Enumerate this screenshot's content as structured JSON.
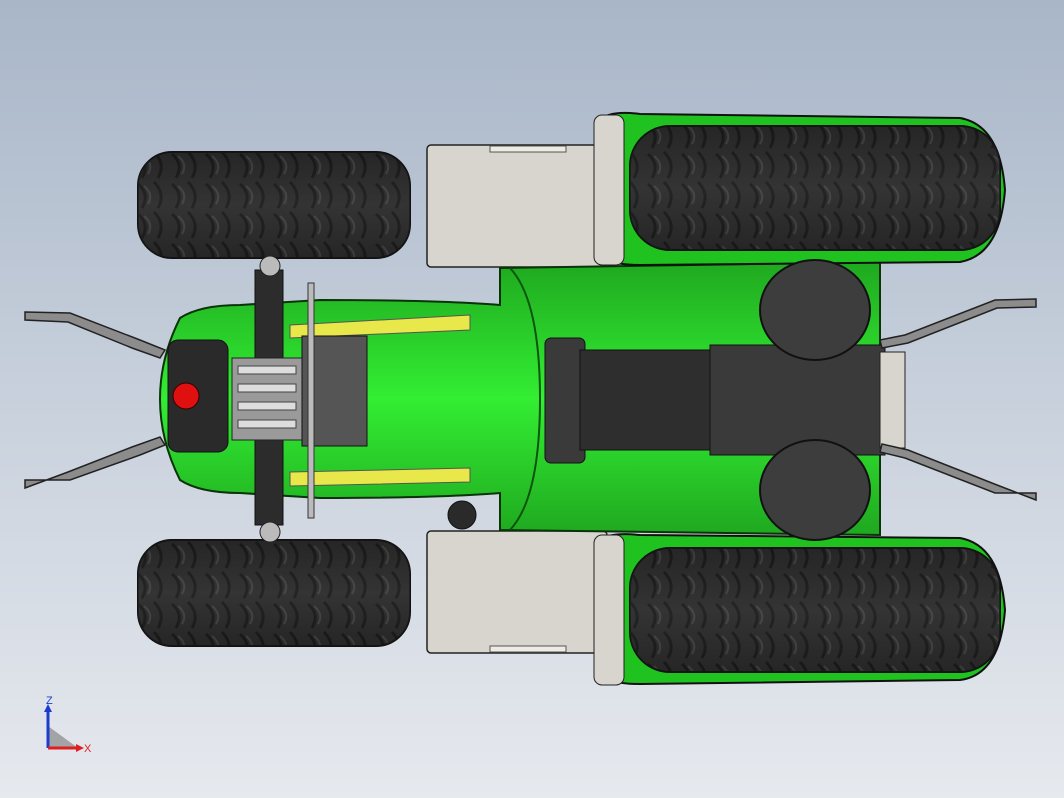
{
  "scene": {
    "subject": "tractor-model-bottom-view",
    "colors": {
      "body_green": "#22dd22",
      "body_green_dark": "#119911",
      "tire_black": "#2a2a2a",
      "tire_tread": "#3c3c3c",
      "fender_grey": "#d6d2cc",
      "metal_dark": "#333333",
      "metal_grey": "#7a7a7a",
      "yellow_trim": "#e8e84a",
      "red_light": "#e01010"
    }
  },
  "triad": {
    "z_label": "Z",
    "x_label": "X",
    "z_color": "#1a3ccf",
    "x_color": "#e02020"
  }
}
